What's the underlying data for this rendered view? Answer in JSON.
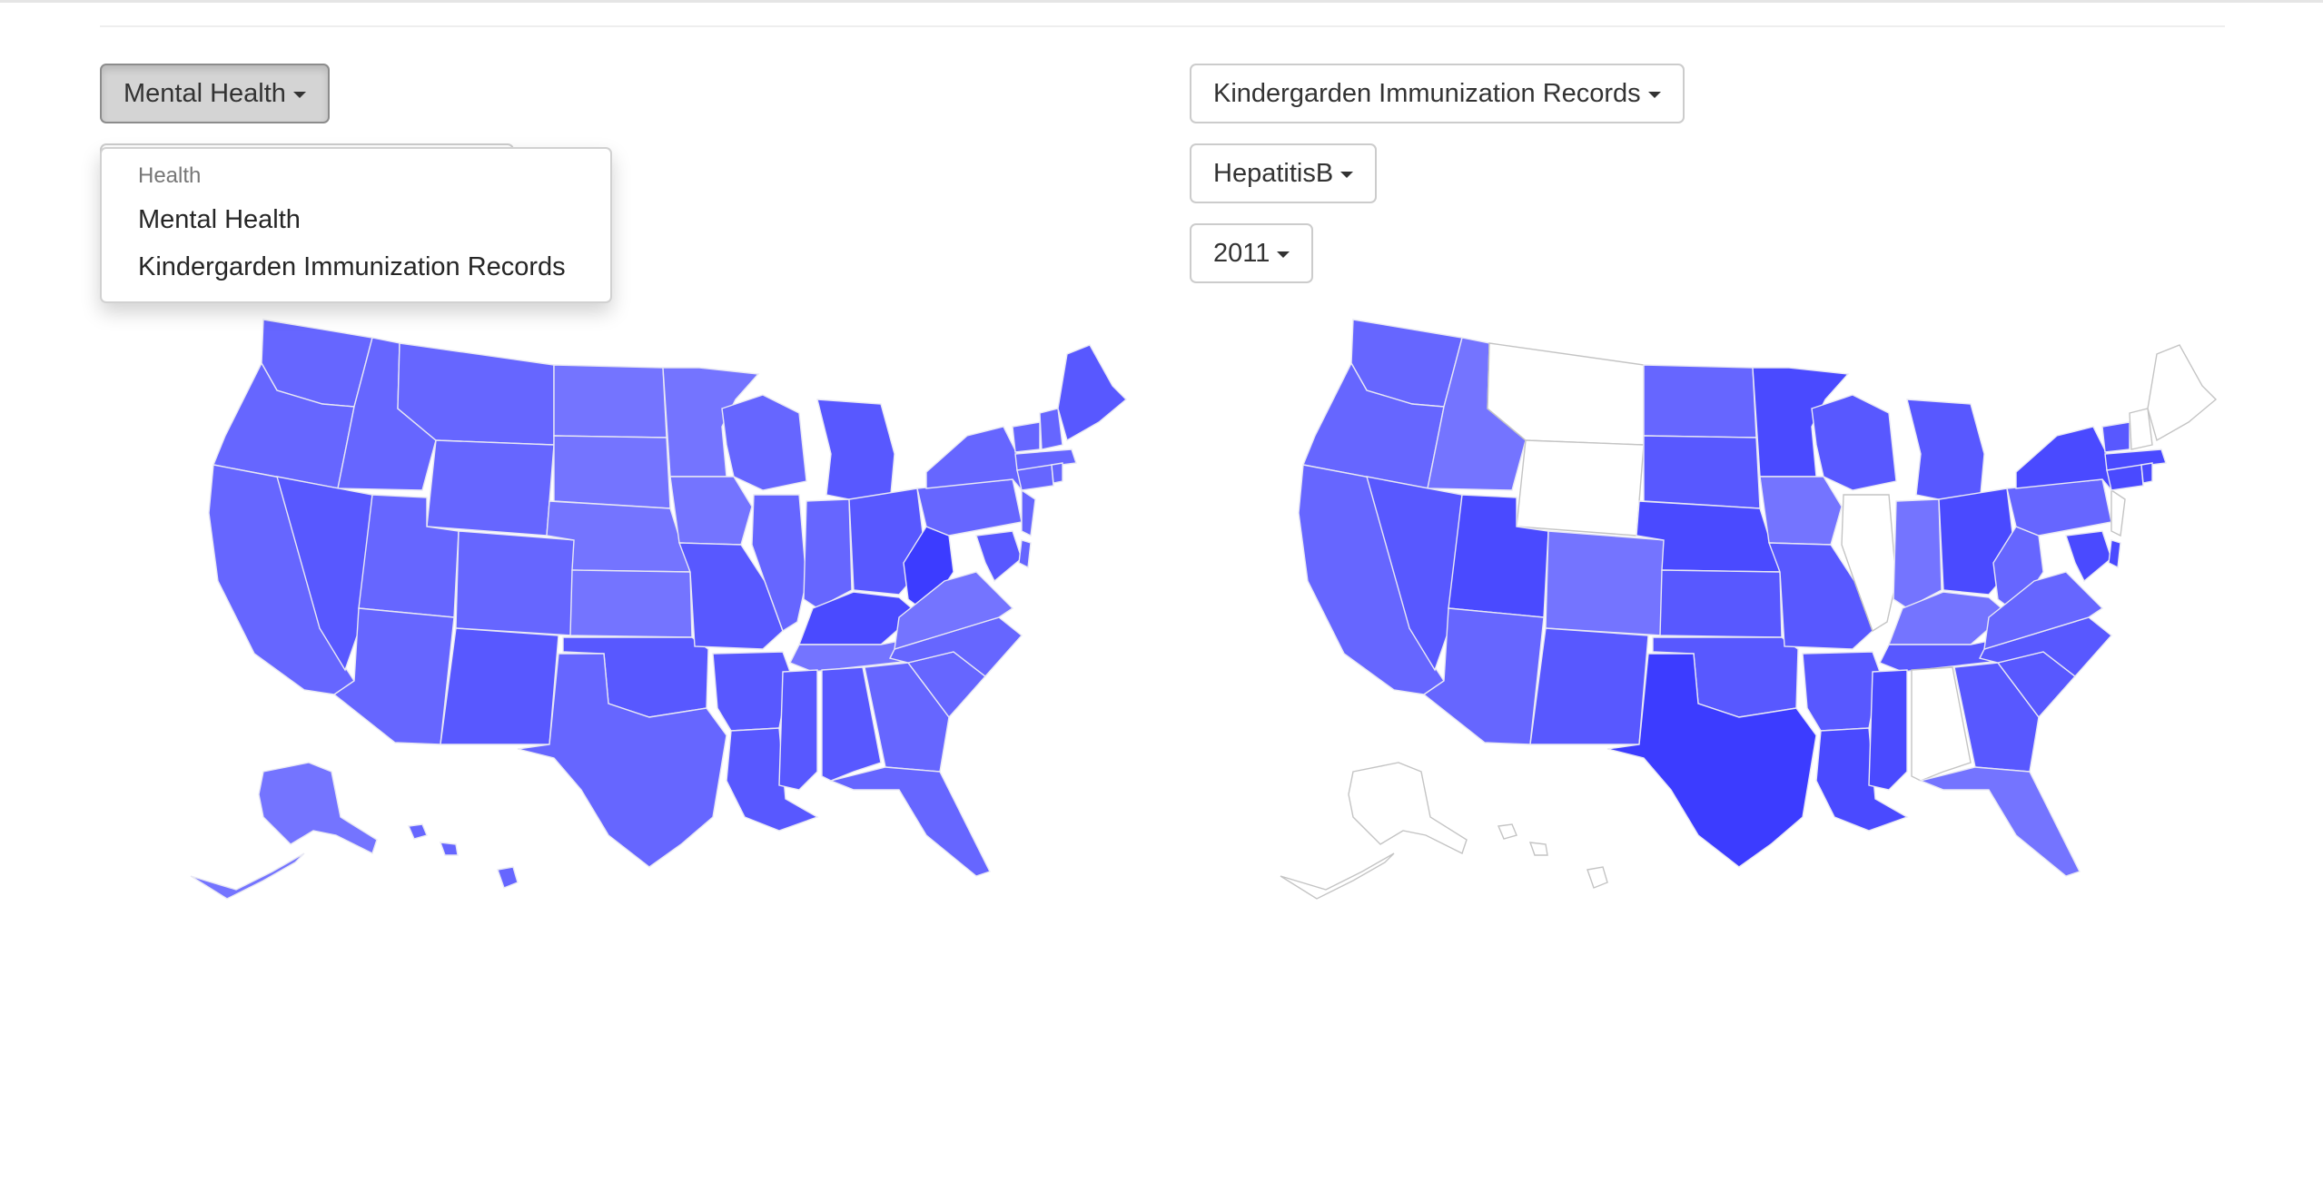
{
  "left_panel": {
    "dataset_button": "Mental Health",
    "dropdown": {
      "header": "Health",
      "items": [
        "Mental Health",
        "Kindergarden Immunization Records"
      ]
    }
  },
  "right_panel": {
    "dataset_button": "Kindergarden Immunization Records",
    "measure_button": "HepatitisB",
    "year_button": "2011"
  },
  "map_colors": {
    "level1": "#7474ff",
    "level2": "#6666ff",
    "level3": "#5858ff",
    "level4": "#4a4aff",
    "level5": "#3c3cff",
    "no_data": "#ffffff"
  },
  "icons": {
    "caret": "caret-down-icon"
  }
}
